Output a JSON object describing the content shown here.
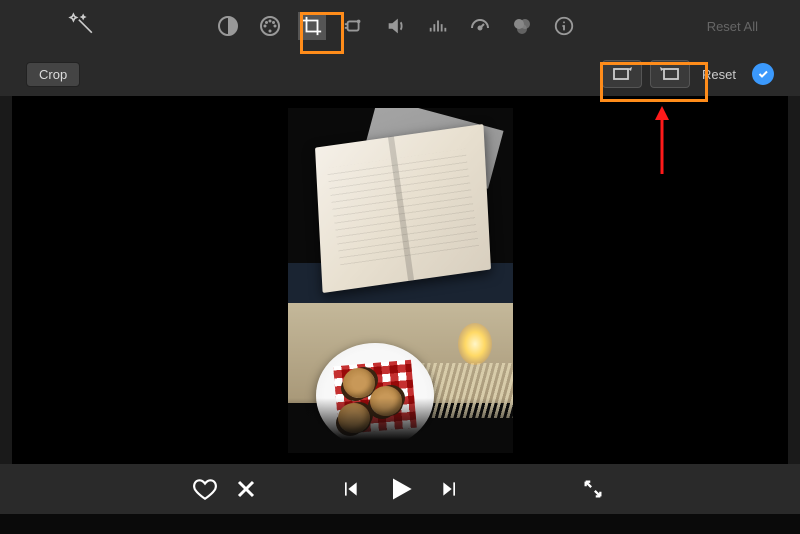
{
  "toolbar": {
    "reset_all_label": "Reset All",
    "tools": [
      {
        "name": "magic-wand",
        "active": false
      },
      {
        "name": "color-balance",
        "active": false
      },
      {
        "name": "color-correction",
        "active": false
      },
      {
        "name": "crop",
        "active": true
      },
      {
        "name": "stabilization",
        "active": false
      },
      {
        "name": "volume",
        "active": false
      },
      {
        "name": "noise-reduction",
        "active": false
      },
      {
        "name": "speed",
        "active": false
      },
      {
        "name": "filters",
        "active": false
      },
      {
        "name": "info",
        "active": false
      }
    ]
  },
  "crop_panel": {
    "crop_button_label": "Crop",
    "reset_label": "Reset"
  },
  "playback": {
    "controls": [
      "favorite",
      "reject",
      "previous",
      "play",
      "next",
      "fullscreen"
    ]
  },
  "annotations": {
    "highlight_color": "#ff8c1a",
    "arrow_color": "#ff1a1a"
  }
}
